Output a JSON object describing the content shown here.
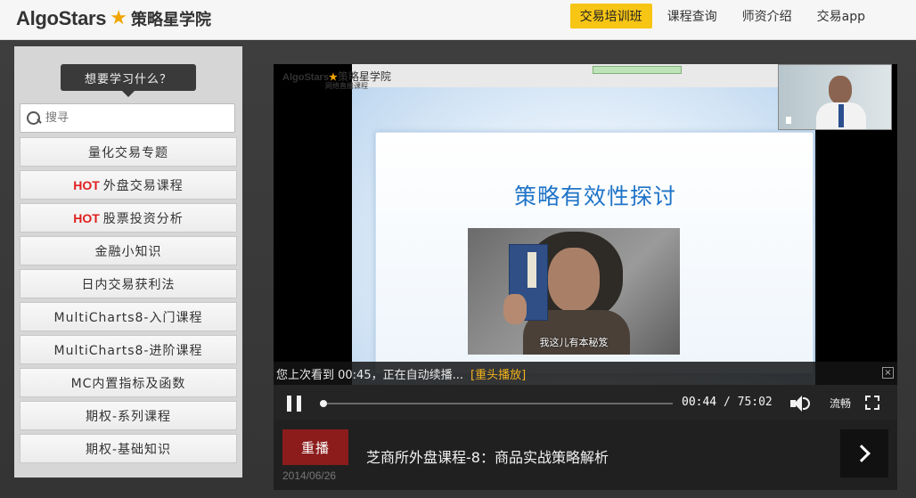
{
  "header": {
    "logo_en": "AlgoStars",
    "logo_cn": "策略星学院",
    "nav": [
      {
        "label": "交易培训班",
        "active": true
      },
      {
        "label": "课程查询",
        "active": false
      },
      {
        "label": "师资介绍",
        "active": false
      },
      {
        "label": "交易app",
        "active": false
      }
    ]
  },
  "sidebar": {
    "prompt": "想要学习什么？",
    "search_placeholder": "搜寻",
    "hot_tag": "HOT",
    "items": [
      {
        "label": "量化交易专题",
        "hot": false
      },
      {
        "label": "外盘交易课程",
        "hot": true
      },
      {
        "label": "股票投资分析",
        "hot": true
      },
      {
        "label": "金融小知识",
        "hot": false
      },
      {
        "label": "日内交易获利法",
        "hot": false
      },
      {
        "label": "MultiCharts8-入门课程",
        "hot": false
      },
      {
        "label": "MultiCharts8-进阶课程",
        "hot": false
      },
      {
        "label": "MC内置指标及函数",
        "hot": false
      },
      {
        "label": "期权-系列课程",
        "hot": false
      },
      {
        "label": "期权-基础知识",
        "hot": false
      }
    ]
  },
  "player": {
    "slide_logo_en": "AlgoStars",
    "slide_logo_cn": "策略星学院",
    "slide_sub": "网络直播课程",
    "slide_title": "策略有效性探讨",
    "photo_caption": "我这儿有本秘笈",
    "resume_text": "您上次看到 00:45，正在自动续播...",
    "resume_link": "[重头播放]",
    "current_time": "00:44",
    "total_time": "/ 75:02",
    "progress": 0.01,
    "quality": "流畅",
    "replay_label": "重播",
    "date": "2014/06/26",
    "course_title": "芝商所外盘课程-8：商品实战策略解析"
  },
  "colors": {
    "accent": "#f7c514",
    "hot": "#e02020",
    "replay": "#8c1c1c",
    "resume_link": "#f3b21c"
  }
}
